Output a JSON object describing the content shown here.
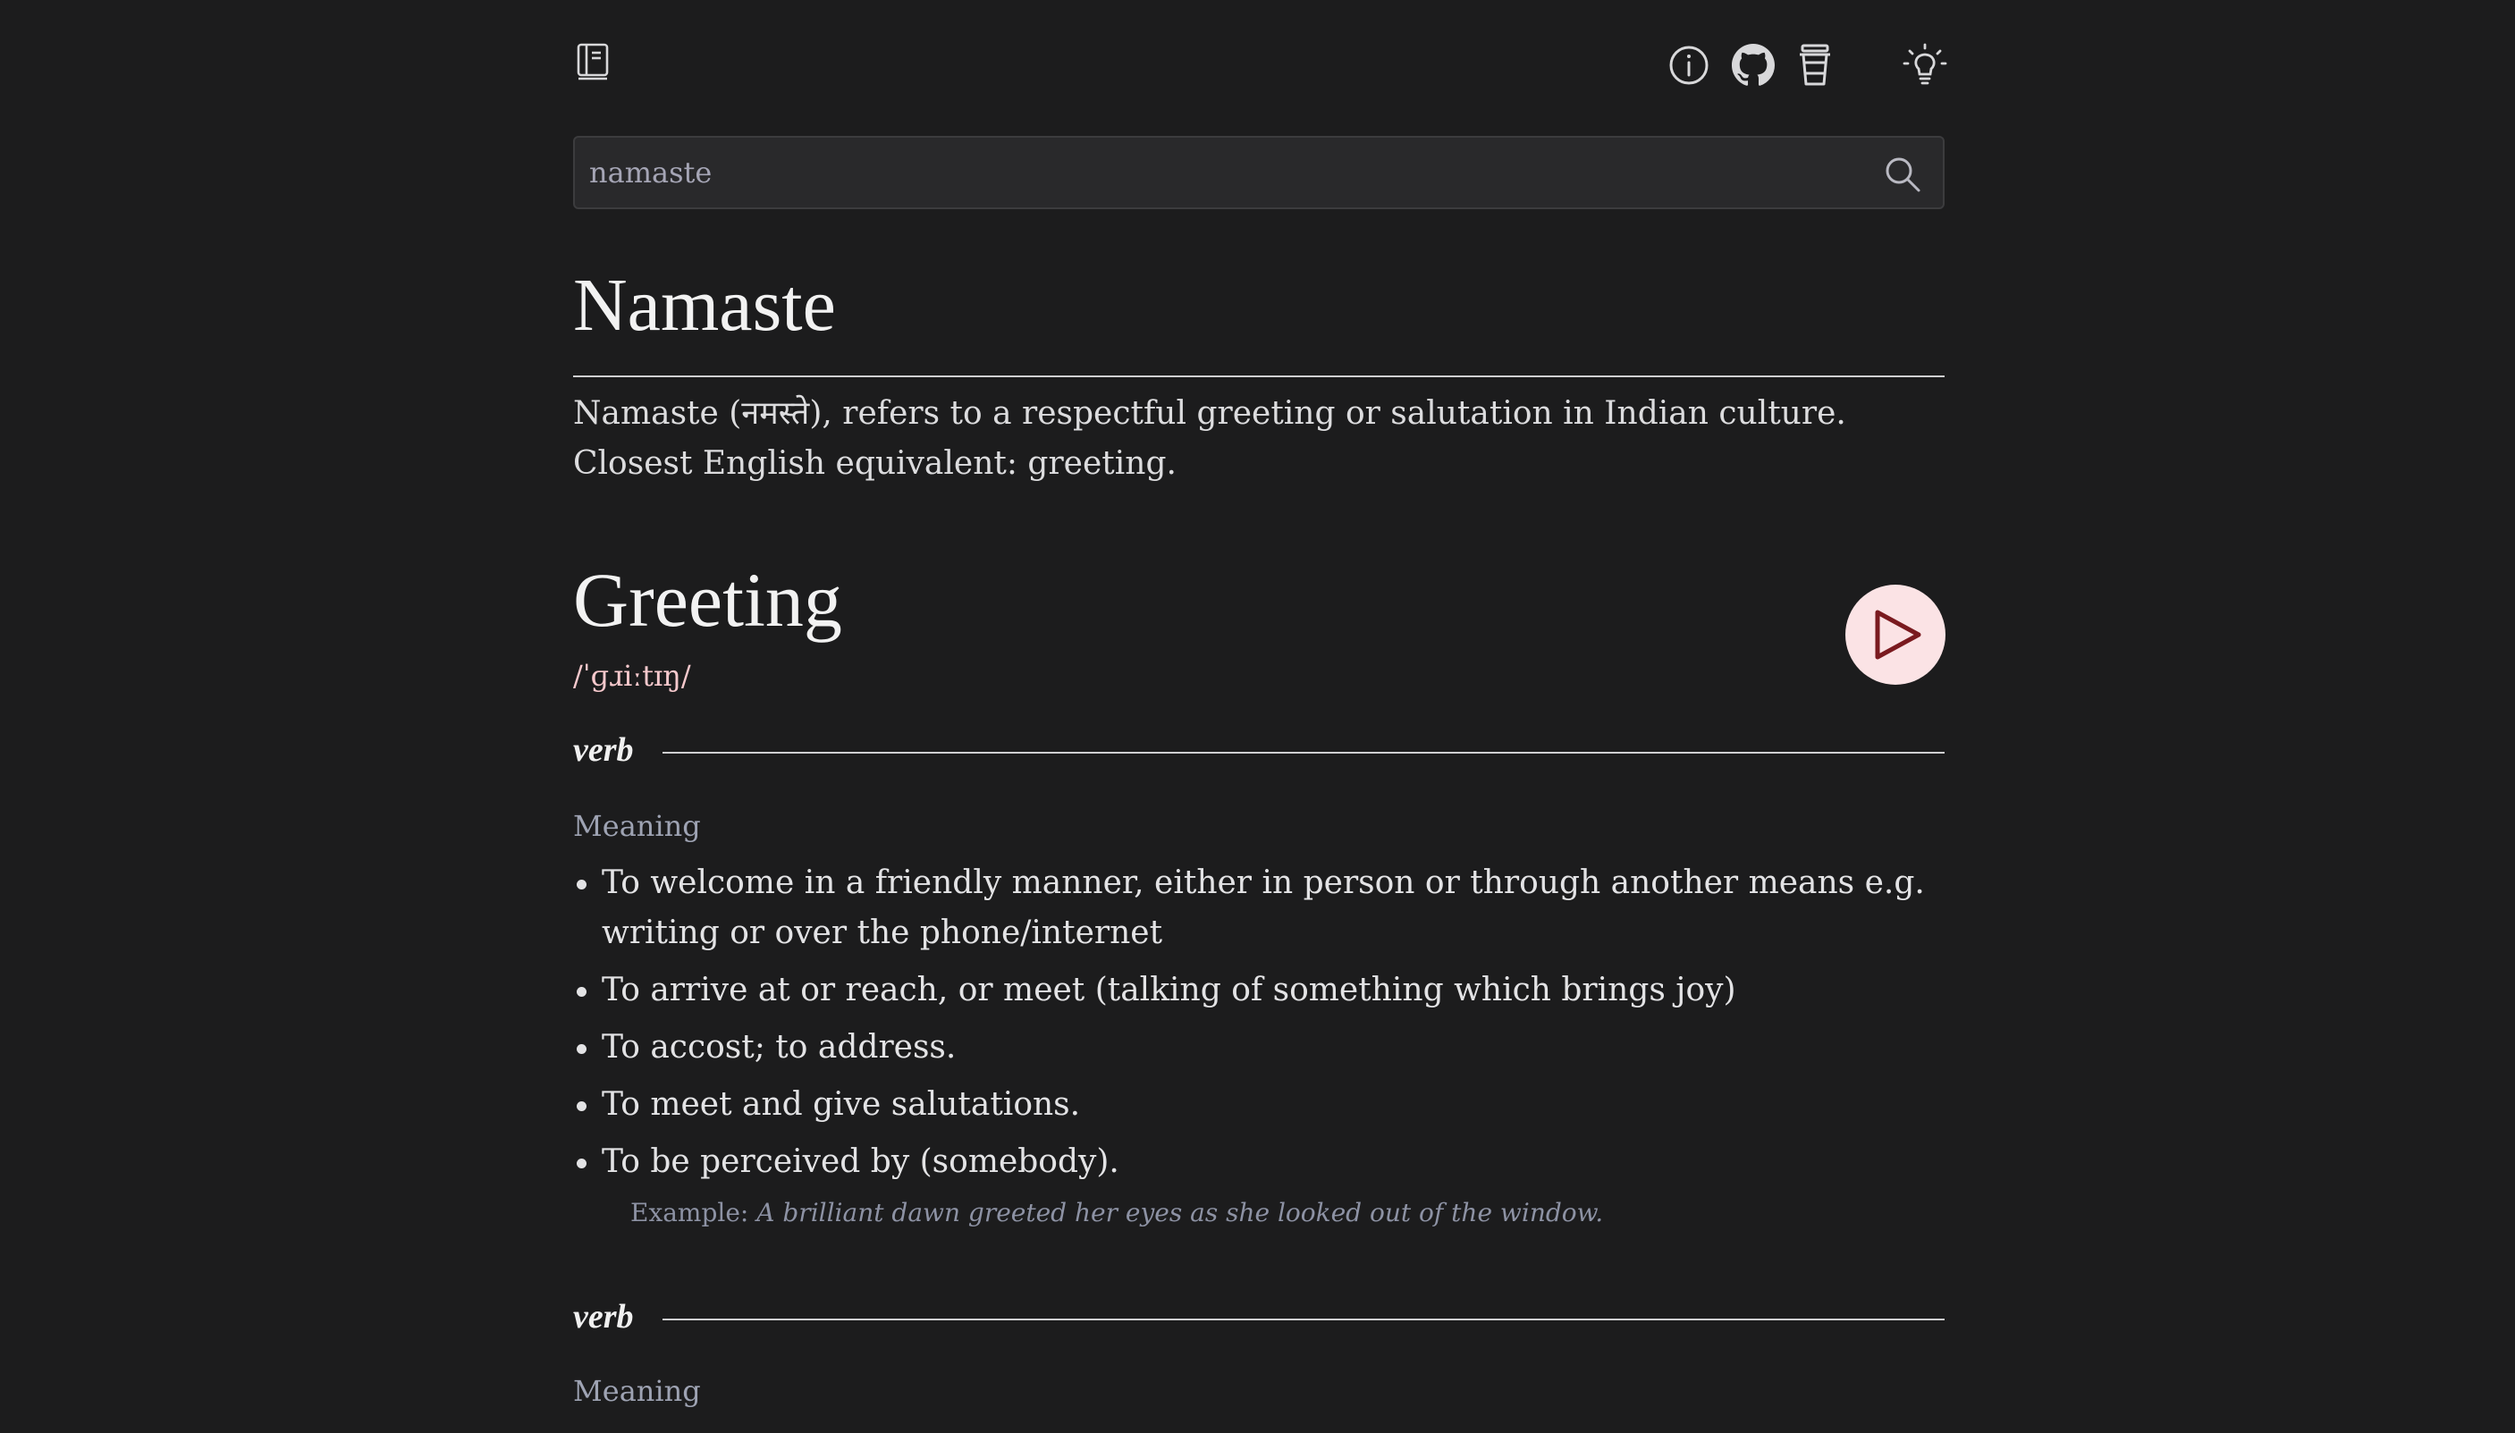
{
  "header": {
    "logo_icon": "book-icon",
    "icons": [
      "info-icon",
      "github-icon",
      "coffee-cup-icon",
      "lightbulb-icon"
    ]
  },
  "search": {
    "value": "namaste",
    "placeholder": "",
    "icon": "search-icon"
  },
  "entry": {
    "title": "Namaste",
    "summary": "Namaste (नमस्ते), refers to a respectful greeting or salutation in Indian culture. Closest English equivalent: greeting."
  },
  "word": {
    "headword": "Greeting",
    "phonetic": "/ˈɡɹiːtɪŋ/",
    "play_icon": "play-icon",
    "sections": [
      {
        "part_of_speech": "verb",
        "meaning_label": "Meaning",
        "definitions": [
          "To welcome in a friendly manner, either in person or through another means e.g. writing or over the phone/internet",
          "To arrive at or reach, or meet (talking of something which brings joy)",
          "To accost; to address.",
          "To meet and give salutations.",
          "To be perceived by (somebody)."
        ],
        "example_label": "Example:",
        "example": "A brilliant dawn greeted her eyes as she looked out of the window."
      },
      {
        "part_of_speech": "verb",
        "meaning_label": "Meaning"
      }
    ]
  },
  "colors": {
    "background": "#1c1c1d",
    "accent": "#fbe3e5",
    "play_icon": "#7a1a1f",
    "phonetic": "#f7c9cd",
    "muted": "#9ea3b3"
  }
}
